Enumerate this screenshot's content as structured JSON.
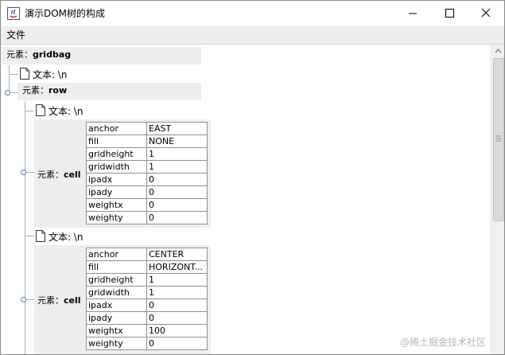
{
  "window": {
    "title": "演示DOM树的构成",
    "minimize_glyph": "—",
    "maximize_glyph": "☐",
    "close_glyph": "✕"
  },
  "menu": {
    "file": "文件"
  },
  "tree": {
    "root": {
      "prefix": "元素：",
      "name": "gridbag"
    },
    "root_text": "文本: \\n",
    "row": {
      "prefix": "元素：",
      "name": "row"
    },
    "row_text_1": "文本: \\n",
    "cell_1": {
      "prefix": "元素：",
      "name": "cell",
      "attributes": [
        [
          "anchor",
          "EAST"
        ],
        [
          "fill",
          "NONE"
        ],
        [
          "gridheight",
          "1"
        ],
        [
          "gridwidth",
          "1"
        ],
        [
          "ipadx",
          "0"
        ],
        [
          "ipady",
          "0"
        ],
        [
          "weightx",
          "0"
        ],
        [
          "weighty",
          "0"
        ]
      ]
    },
    "row_text_2": "文本: \\n",
    "cell_2": {
      "prefix": "元素：",
      "name": "cell",
      "attributes": [
        [
          "anchor",
          "CENTER"
        ],
        [
          "fill",
          "HORIZONT..."
        ],
        [
          "gridheight",
          "1"
        ],
        [
          "gridwidth",
          "1"
        ],
        [
          "ipadx",
          "0"
        ],
        [
          "ipady",
          "0"
        ],
        [
          "weightx",
          "100"
        ],
        [
          "weighty",
          "0"
        ]
      ]
    }
  },
  "watermark": "@稀土掘金技术社区",
  "colors": {
    "tree_line": "#9eb3c7",
    "node_bg": "#eeeeee",
    "menubar_bg": "#eeeeee"
  }
}
